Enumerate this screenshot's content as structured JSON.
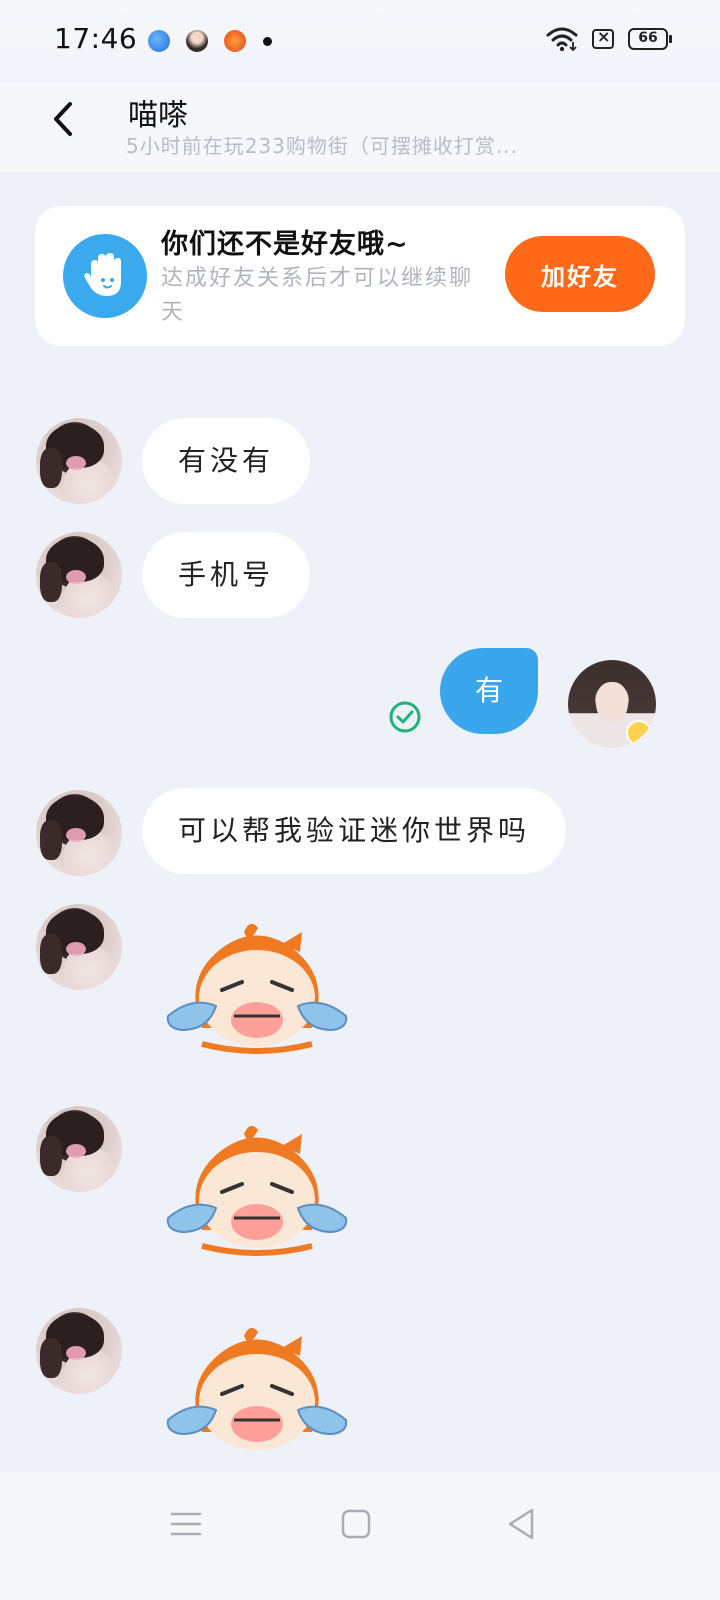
{
  "status_bar": {
    "time": "17:46",
    "battery": "66",
    "icons": [
      "app-notification-icon",
      "avatar-notification-icon",
      "store-notification-icon",
      "dot-icon",
      "wifi-icon",
      "sim-icon",
      "battery-icon"
    ]
  },
  "header": {
    "title": "喵嗏",
    "subtitle": "5小时前在玩233购物街（可摆摊收打赏..."
  },
  "friend_banner": {
    "title": "你们还不是好友哦~",
    "text": "达成好友关系后才可以继续聊天",
    "button_label": "加好友",
    "accent": "#ff6a1a",
    "icon": "wave-hand-icon"
  },
  "messages": [
    {
      "from": "other",
      "type": "text",
      "text": "有没有"
    },
    {
      "from": "other",
      "type": "text",
      "text": "手机号"
    },
    {
      "from": "me",
      "type": "text",
      "text": "有",
      "status": "read"
    },
    {
      "from": "other",
      "type": "text",
      "text": "可以帮我验证迷你世界吗"
    },
    {
      "from": "other",
      "type": "sticker",
      "sticker": "crying-cat-sticker"
    },
    {
      "from": "other",
      "type": "sticker",
      "sticker": "crying-cat-sticker"
    },
    {
      "from": "other",
      "type": "sticker",
      "sticker": "crying-cat-sticker"
    }
  ],
  "nav_bar": {
    "icons": [
      "menu-icon",
      "home-icon",
      "back-triangle-icon"
    ]
  },
  "colors": {
    "my_bubble": "#3aa6ec",
    "other_bubble": "#ffffff",
    "background": "#eef1f7",
    "read_check": "#20b27a"
  }
}
